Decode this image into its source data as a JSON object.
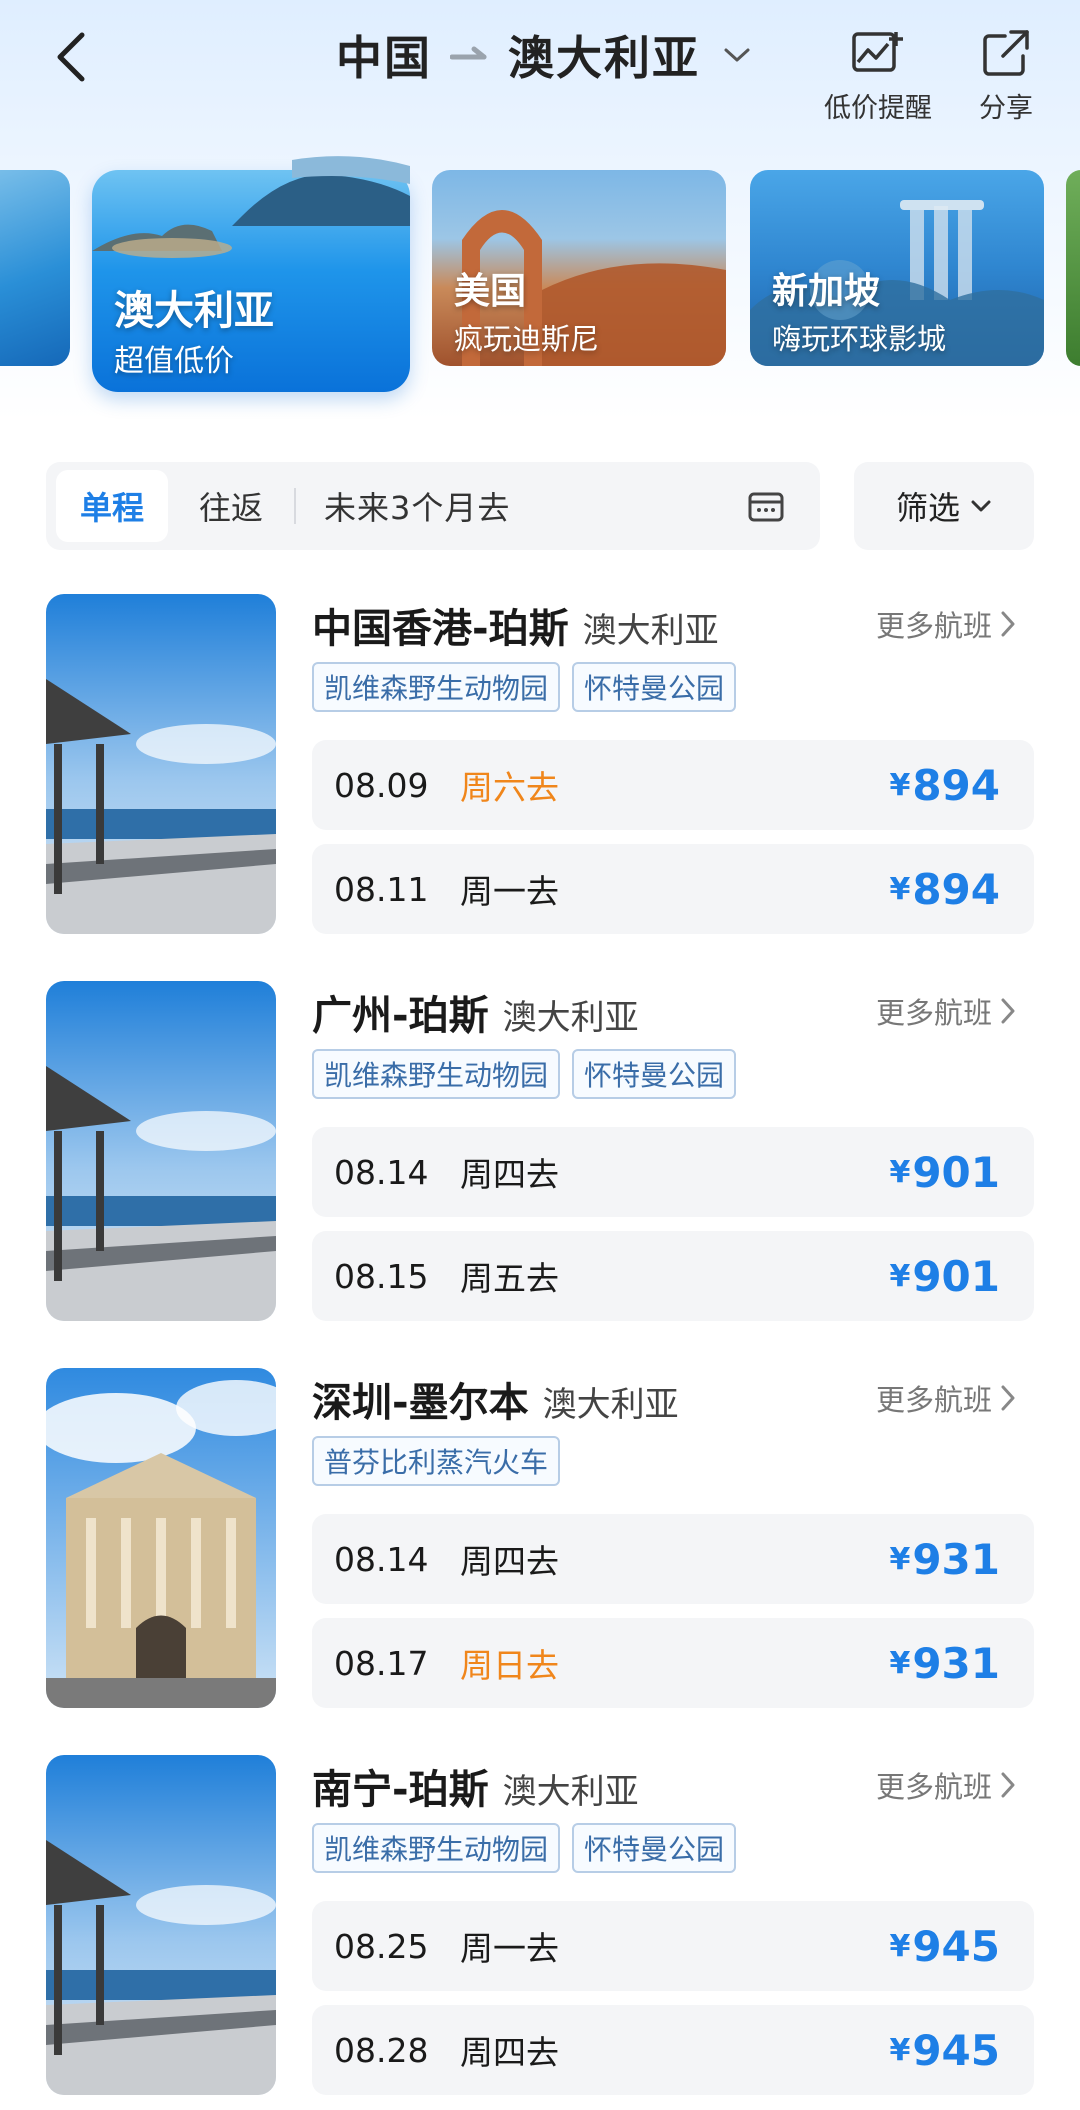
{
  "header": {
    "origin": "中国",
    "destination": "澳大利亚",
    "actions": [
      {
        "label": "低价提醒",
        "icon": "price-alert-icon"
      },
      {
        "label": "分享",
        "icon": "share-icon"
      }
    ]
  },
  "destinations": [
    {
      "name": "澳大利亚",
      "subtitle": "超值低价",
      "selected": true
    },
    {
      "name": "美国",
      "subtitle": "疯玩迪斯尼",
      "selected": false
    },
    {
      "name": "新加坡",
      "subtitle": "嗨玩环球影城",
      "selected": false
    }
  ],
  "filter": {
    "tabs": [
      "单程",
      "往返"
    ],
    "active_tab": "单程",
    "date_range": "未来3个月去",
    "filter_label": "筛选"
  },
  "routes": [
    {
      "name": "中国香港-珀斯",
      "country": "澳大利亚",
      "more_label": "更多航班",
      "tags": [
        "凯维森野生动物园",
        "怀特曼公园"
      ],
      "fares": [
        {
          "date": "08.09",
          "day": "周六去",
          "price": "894",
          "weekend": true
        },
        {
          "date": "08.11",
          "day": "周一去",
          "price": "894",
          "weekend": false
        }
      ]
    },
    {
      "name": "广州-珀斯",
      "country": "澳大利亚",
      "more_label": "更多航班",
      "tags": [
        "凯维森野生动物园",
        "怀特曼公园"
      ],
      "fares": [
        {
          "date": "08.14",
          "day": "周四去",
          "price": "901",
          "weekend": false
        },
        {
          "date": "08.15",
          "day": "周五去",
          "price": "901",
          "weekend": false
        }
      ]
    },
    {
      "name": "深圳-墨尔本",
      "country": "澳大利亚",
      "more_label": "更多航班",
      "tags": [
        "普芬比利蒸汽火车"
      ],
      "fares": [
        {
          "date": "08.14",
          "day": "周四去",
          "price": "931",
          "weekend": false
        },
        {
          "date": "08.17",
          "day": "周日去",
          "price": "931",
          "weekend": true
        }
      ]
    },
    {
      "name": "南宁-珀斯",
      "country": "澳大利亚",
      "more_label": "更多航班",
      "tags": [
        "凯维森野生动物园",
        "怀特曼公园"
      ],
      "fares": [
        {
          "date": "08.25",
          "day": "周一去",
          "price": "945",
          "weekend": false
        },
        {
          "date": "08.28",
          "day": "周四去",
          "price": "945",
          "weekend": false
        }
      ]
    }
  ],
  "currency_symbol": "¥",
  "colors": {
    "accent": "#1e7fe6",
    "weekend": "#f0861b",
    "fare_bg": "#f4f5f7"
  }
}
